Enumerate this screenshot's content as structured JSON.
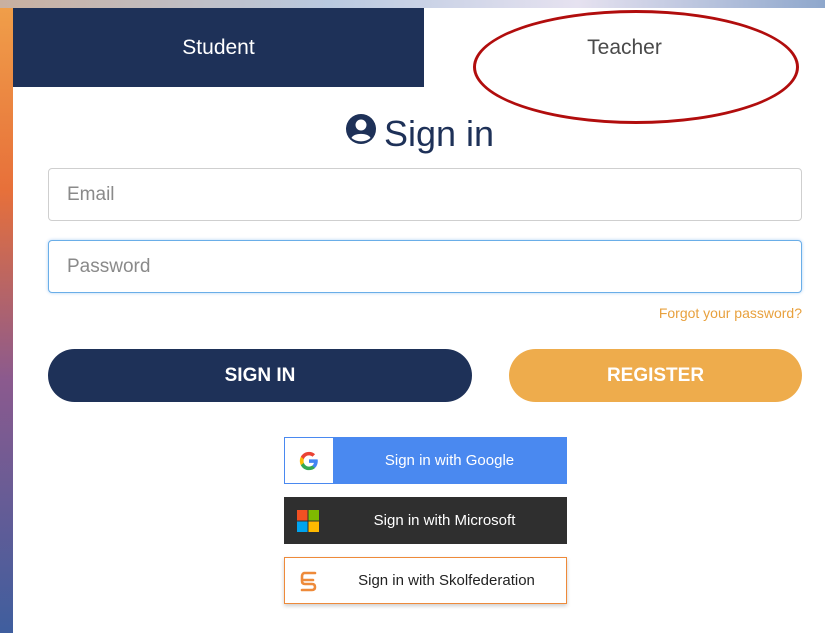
{
  "tabs": {
    "student": "Student",
    "teacher": "Teacher"
  },
  "title": "Sign in",
  "form": {
    "email_placeholder": "Email",
    "password_placeholder": "Password",
    "forgot": "Forgot your password?"
  },
  "buttons": {
    "sign_in": "SIGN IN",
    "register": "REGISTER"
  },
  "sso": {
    "google": "Sign in with Google",
    "microsoft": "Sign in with Microsoft",
    "skolfederation": "Sign in with Skolfederation"
  },
  "colors": {
    "navy": "#1e3158",
    "accent": "#eeac4c",
    "google_blue": "#4a89f0",
    "annotation": "#b10d0d"
  },
  "icons": [
    "user-circle-icon",
    "google-icon",
    "microsoft-icon",
    "skolfederation-icon"
  ]
}
